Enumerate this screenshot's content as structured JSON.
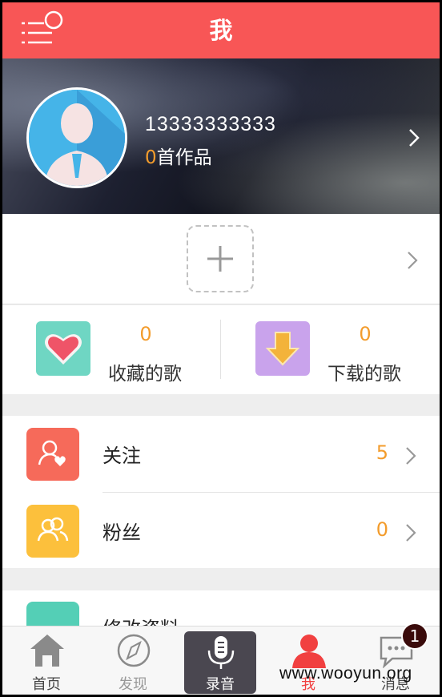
{
  "header": {
    "title": "我",
    "menu_icon": "menu-icon"
  },
  "profile": {
    "phone": "13333333333",
    "works_count": "0",
    "works_label": "首作品",
    "avatar_icon": "avatar-icon"
  },
  "add_work": {
    "icon": "plus-icon"
  },
  "stats": [
    {
      "count": "0",
      "label": "收藏的歌",
      "icon": "heart-icon",
      "color": "#6fd6c3"
    },
    {
      "count": "0",
      "label": "下载的歌",
      "icon": "download-icon",
      "color": "#c9a3ec"
    }
  ],
  "list": [
    {
      "label": "关注",
      "count": "5",
      "icon": "follow-icon",
      "color": "#f66a5a"
    },
    {
      "label": "粉丝",
      "count": "0",
      "icon": "fans-icon",
      "color": "#fcc03c"
    },
    {
      "label": "修改资料",
      "icon": "edit-profile-icon",
      "color": "#54cfb6"
    }
  ],
  "bottom_nav": [
    {
      "label": "首页",
      "icon": "home-icon"
    },
    {
      "label": "发现",
      "icon": "compass-icon"
    },
    {
      "label": "录音",
      "icon": "microphone-icon"
    },
    {
      "label": "我",
      "icon": "user-icon"
    },
    {
      "label": "消息",
      "icon": "message-icon",
      "badge": "1"
    }
  ],
  "watermark": "www.wooyun.org",
  "colors": {
    "accent": "#f85656",
    "count": "#f39c2c"
  }
}
